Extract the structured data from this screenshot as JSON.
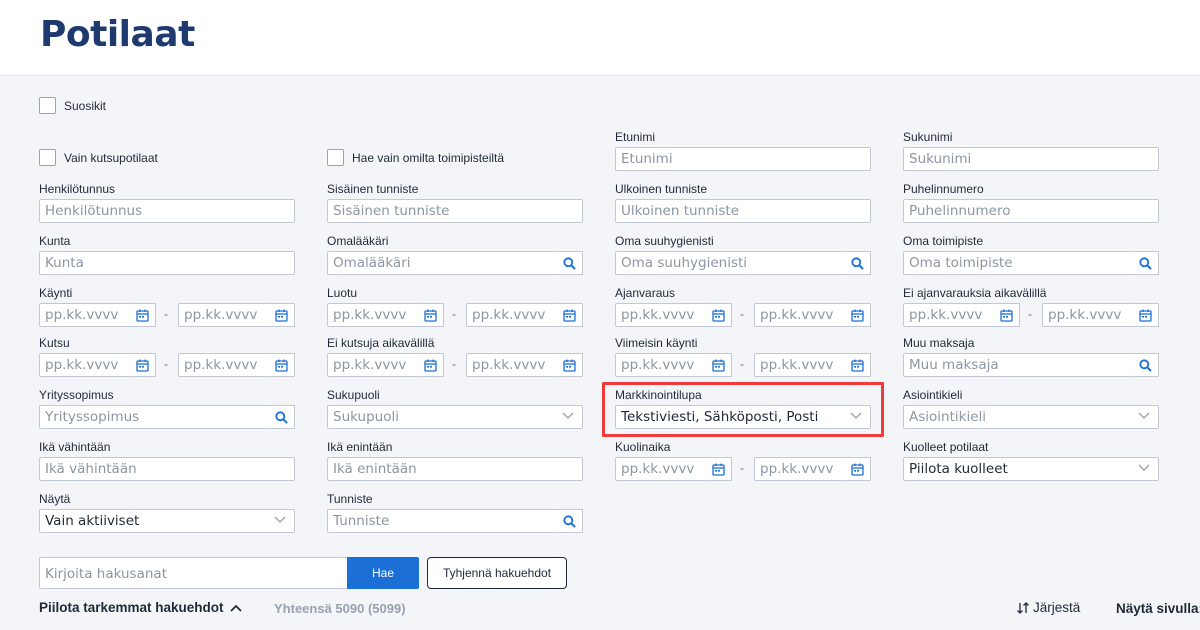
{
  "page": {
    "title": "Potilaat"
  },
  "filters": {
    "favorites": "Suosikit",
    "invite_only": "Vain kutsupotilaat",
    "own_sites_only": "Hae vain omilta toimipisteiltä",
    "first_name": {
      "label": "Etunimi",
      "placeholder": "Etunimi"
    },
    "last_name": {
      "label": "Sukunimi",
      "placeholder": "Sukunimi"
    },
    "ssn": {
      "label": "Henkilötunnus",
      "placeholder": "Henkilötunnus"
    },
    "internal_id": {
      "label": "Sisäinen tunniste",
      "placeholder": "Sisäinen tunniste"
    },
    "external_id": {
      "label": "Ulkoinen tunniste",
      "placeholder": "Ulkoinen tunniste"
    },
    "phone": {
      "label": "Puhelinnumero",
      "placeholder": "Puhelinnumero"
    },
    "municipality": {
      "label": "Kunta",
      "placeholder": "Kunta"
    },
    "own_doctor": {
      "label": "Omalääkäri",
      "placeholder": "Omalääkäri"
    },
    "own_hygienist": {
      "label": "Oma suuhygienisti",
      "placeholder": "Oma suuhygienisti"
    },
    "own_site": {
      "label": "Oma toimipiste",
      "placeholder": "Oma toimipiste"
    },
    "visit": {
      "label": "Käynti"
    },
    "created": {
      "label": "Luotu"
    },
    "appointment": {
      "label": "Ajanvaraus"
    },
    "no_appointments_between": {
      "label": "Ei ajanvarauksia aikavälillä"
    },
    "invite": {
      "label": "Kutsu"
    },
    "no_invites_between": {
      "label": "Ei kutsuja aikavälillä"
    },
    "last_visit": {
      "label": "Viimeisin käynti"
    },
    "other_payer": {
      "label": "Muu maksaja",
      "placeholder": "Muu maksaja"
    },
    "company_contract": {
      "label": "Yrityssopimus",
      "placeholder": "Yrityssopimus"
    },
    "gender": {
      "label": "Sukupuoli",
      "placeholder": "Sukupuoli"
    },
    "marketing_permission": {
      "label": "Markkinointilupa",
      "value": "Tekstiviesti, Sähköposti, Posti"
    },
    "service_language": {
      "label": "Asiointikieli",
      "placeholder": "Asiointikieli"
    },
    "age_min": {
      "label": "Ikä vähintään",
      "placeholder": "Ikä vähintään"
    },
    "age_max": {
      "label": "Ikä enintään",
      "placeholder": "Ikä enintään"
    },
    "death_date": {
      "label": "Kuolinaika"
    },
    "deceased": {
      "label": "Kuolleet potilaat",
      "value": "Piilota kuolleet"
    },
    "show": {
      "label": "Näytä",
      "value": "Vain aktiiviset"
    },
    "identifier": {
      "label": "Tunniste",
      "placeholder": "Tunniste"
    },
    "date_placeholder": "pp.kk.vvvv",
    "range_separator": "-"
  },
  "search": {
    "placeholder": "Kirjoita hakusanat",
    "search_button": "Hae",
    "clear_button": "Tyhjennä hakuehdot"
  },
  "footer": {
    "hide_advanced": "Piilota tarkemmat hakuehdot",
    "total": "Yhteensä 5090 (5099)",
    "sort": "Järjestä",
    "per_page": "Näytä sivulla:"
  },
  "colors": {
    "title": "#1f3a6e",
    "accent": "#1b6fd6",
    "highlight": "#ef3b3b"
  }
}
